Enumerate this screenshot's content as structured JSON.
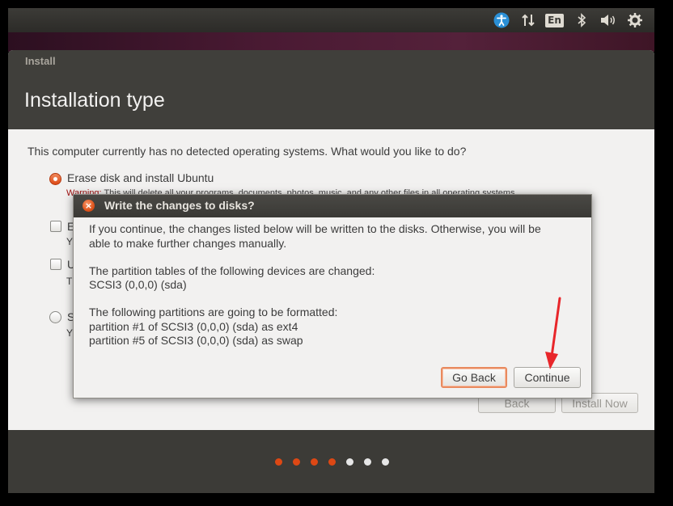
{
  "colors": {
    "accent": "#dd4814",
    "header_bg": "#403f3b",
    "window_bg": "#f2f1f0",
    "warning": "#a01010"
  },
  "top_panel": {
    "indicators": [
      {
        "icon": "accessibility-icon"
      },
      {
        "icon": "network-arrows-icon"
      },
      {
        "icon": "keyboard-layout-icon",
        "label": "En"
      },
      {
        "icon": "bluetooth-icon"
      },
      {
        "icon": "volume-icon"
      },
      {
        "icon": "settings-gear-icon"
      }
    ]
  },
  "window": {
    "title": "Install",
    "page_title": "Installation type",
    "question": "This computer currently has no detected operating systems. What would you like to do?",
    "options": [
      {
        "label": "Erase disk and install Ubuntu",
        "selected": true
      },
      {
        "label": "E",
        "sub": "Y"
      },
      {
        "label": "U",
        "sub": "T"
      },
      {
        "label": "S",
        "sub": "Y"
      }
    ],
    "warning_prefix": "Warning:",
    "warning_text": " This will delete all your programs, documents, photos, music, and any other files in all operating systems.",
    "back_label": "Back",
    "install_label": "Install Now",
    "progress": {
      "total": 7,
      "completed": 4
    }
  },
  "dialog": {
    "title": "Write the changes to disks?",
    "intro_line1": "If you continue, the changes listed below will be written to the disks. Otherwise, you will be",
    "intro_line2": "able to make further changes manually.",
    "tables_heading": "The partition tables of the following devices are changed:",
    "tables_device": " SCSI3 (0,0,0) (sda)",
    "format_heading": "The following partitions are going to be formatted:",
    "format_items": [
      " partition #1 of SCSI3 (0,0,0) (sda) as ext4",
      " partition #5 of SCSI3 (0,0,0) (sda) as swap"
    ],
    "go_back_label": "Go Back",
    "continue_label": "Continue"
  }
}
